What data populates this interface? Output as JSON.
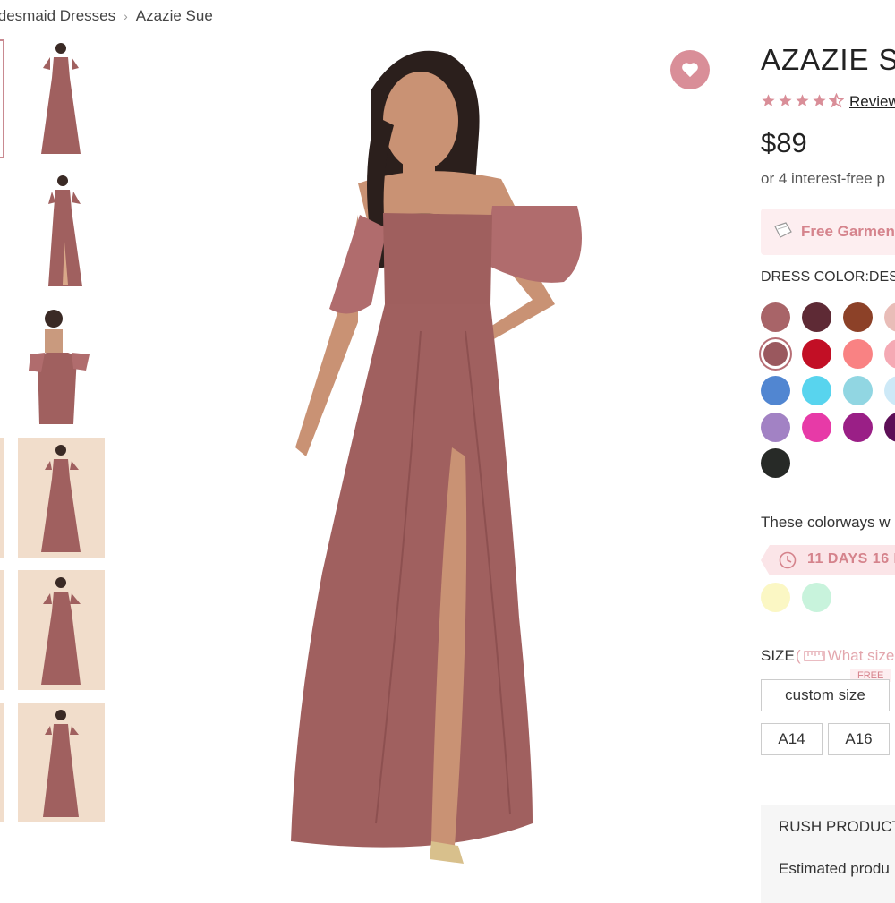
{
  "breadcrumb": {
    "items": [
      "idesmaid Dresses",
      "Azazie Sue"
    ]
  },
  "product": {
    "title": "AZAZIE SU",
    "reviews_label": "Review",
    "rating": 4.5,
    "price": "$89",
    "installments": "or 4 interest-free p",
    "promo": "Free Garmen",
    "favorite_icon": "heart-icon",
    "colors": {
      "label": "DRESS COLOR:DES",
      "swatches": [
        "#a86468",
        "#5e2a35",
        "#8c4128",
        "#e9bdb8",
        "#9a585e",
        "#c20f25",
        "#f98283",
        "#f5a9b4",
        "#5186d1",
        "#58d4ee",
        "#91d6e2",
        "#cde9f7",
        "#a282c4",
        "#e73aa7",
        "#9a1f86",
        "#5d0f57",
        "#272a27"
      ],
      "selected_index": 4,
      "colorways_note": "These colorways w",
      "countdown": "11 DAYS 16 I",
      "limited_swatches": [
        "#fbf7c4",
        "#c8f3dc"
      ]
    },
    "size": {
      "label": "SIZE",
      "help_prefix": "(",
      "help_text": "What size",
      "free_badge": "FREE",
      "options": [
        "custom size",
        "A14",
        "A16"
      ]
    },
    "rush": {
      "title": "RUSH PRODUCT",
      "estimate": "Estimated produ"
    }
  },
  "theme": {
    "accent": "#d98e98",
    "dress": "#a0605f",
    "thumb_bg": "#f1ddcb"
  }
}
